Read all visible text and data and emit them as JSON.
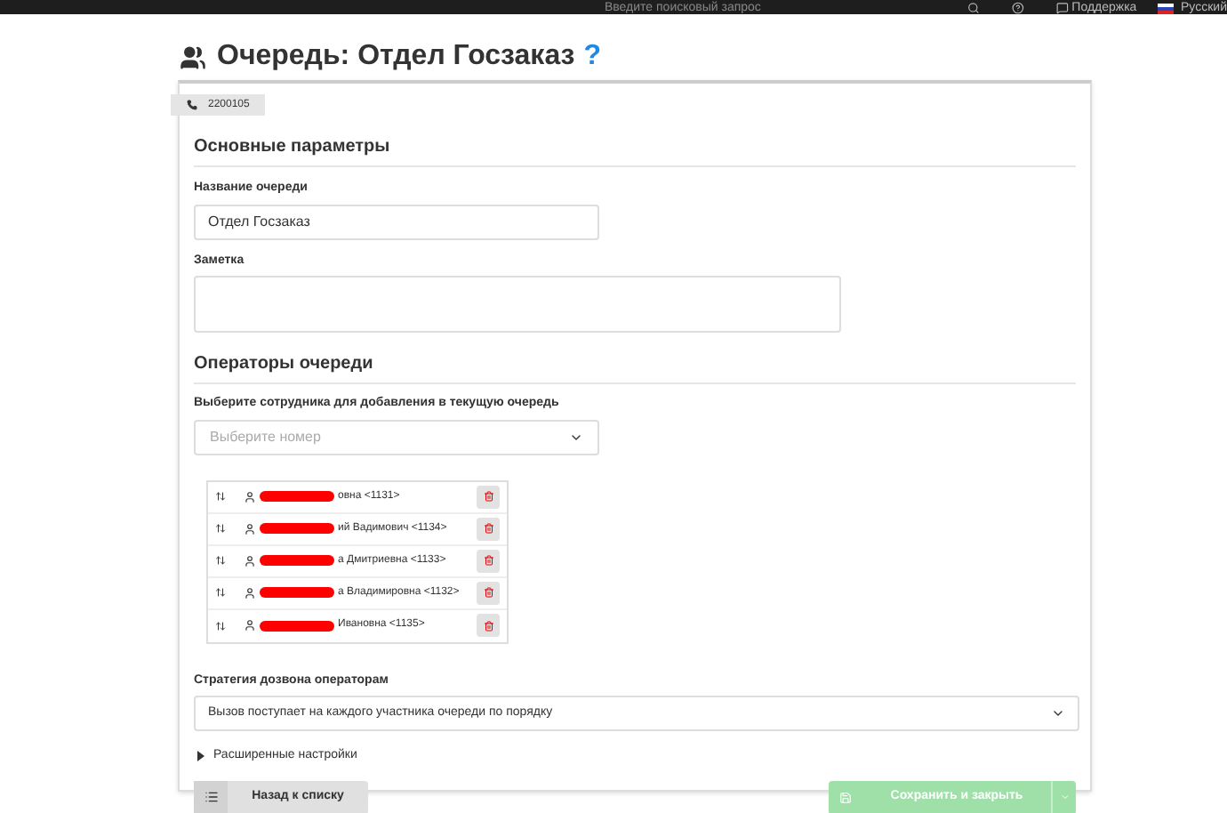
{
  "topbar": {
    "search_placeholder": "Введите поисковый запрос",
    "support": "Поддержка",
    "language": "Русский"
  },
  "title": "Очередь: Отдел Госзаказ",
  "help": "?",
  "tag": "2200105",
  "section_main": "Основные параметры",
  "name_label": "Название очереди",
  "name_value": "Отдел Госзаказ",
  "note_label": "Заметка",
  "section_operators": "Операторы очереди",
  "employee_label": "Выберите сотрудника для добавления в текущую очередь",
  "employee_placeholder": "Выберите номер",
  "operators": [
    {
      "name": "овна <1131>"
    },
    {
      "name": "ий Вадимович <1134>"
    },
    {
      "name": "а Дмитриевна <1133>"
    },
    {
      "name": "а Владимировна <1132>"
    },
    {
      "name": "Ивановна <1135>"
    }
  ],
  "strategy_label": "Стратегия дозвона операторам",
  "strategy_value": "Вызов поступает на каждого участника очереди по порядку",
  "advanced": {
    "label": "Расширенные настройки",
    "expanded": false
  },
  "back_button": "Назад к списку",
  "save_button": {
    "label": "Сохранить и закрыть",
    "disabled": true
  }
}
